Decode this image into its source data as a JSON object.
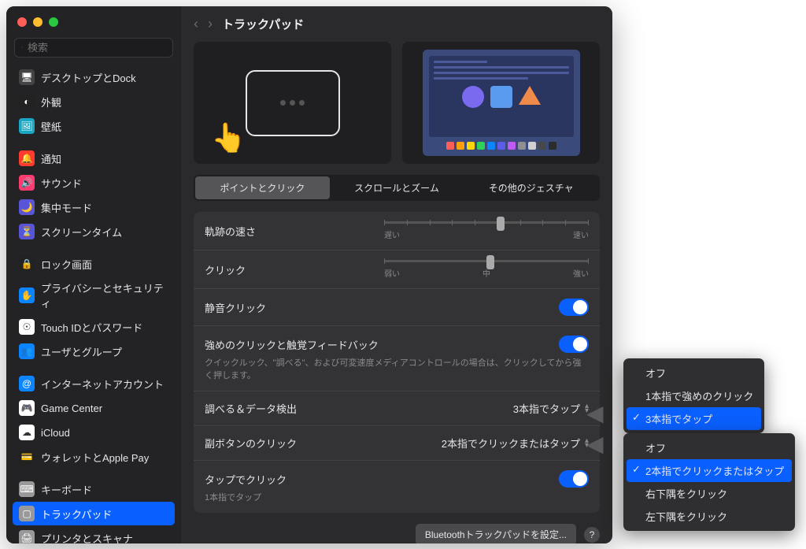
{
  "window": {
    "title": "トラックパッド",
    "search_placeholder": "検索"
  },
  "sidebar": [
    {
      "label": "デスクトップとDock",
      "icon": "desktop",
      "bg": "#444"
    },
    {
      "label": "外観",
      "icon": "appearance",
      "bg": "#222"
    },
    {
      "label": "壁紙",
      "icon": "wallpaper",
      "bg": "#1aa7c4"
    },
    {
      "sep": true
    },
    {
      "label": "通知",
      "icon": "bell",
      "bg": "#ff3b30"
    },
    {
      "label": "サウンド",
      "icon": "sound",
      "bg": "#ff3b70"
    },
    {
      "label": "集中モード",
      "icon": "focus",
      "bg": "#5856d6"
    },
    {
      "label": "スクリーンタイム",
      "icon": "hourglass",
      "bg": "#5856d6"
    },
    {
      "sep": true
    },
    {
      "label": "ロック画面",
      "icon": "lock",
      "bg": "#222"
    },
    {
      "label": "プライバシーとセキュリティ",
      "icon": "privacy",
      "bg": "#0a84ff"
    },
    {
      "label": "Touch IDとパスワード",
      "icon": "touchid",
      "bg": "#fff"
    },
    {
      "label": "ユーザとグループ",
      "icon": "users",
      "bg": "#0a84ff"
    },
    {
      "sep": true
    },
    {
      "label": "インターネットアカウント",
      "icon": "at",
      "bg": "#0a84ff"
    },
    {
      "label": "Game Center",
      "icon": "gamecenter",
      "bg": "#fff"
    },
    {
      "label": "iCloud",
      "icon": "icloud",
      "bg": "#fff"
    },
    {
      "label": "ウォレットとApple Pay",
      "icon": "wallet",
      "bg": "#222"
    },
    {
      "sep": true
    },
    {
      "label": "キーボード",
      "icon": "keyboard",
      "bg": "#999"
    },
    {
      "label": "トラックパッド",
      "icon": "trackpad",
      "bg": "#999",
      "selected": true
    },
    {
      "label": "プリンタとスキャナ",
      "icon": "printer",
      "bg": "#999"
    }
  ],
  "tabs": [
    {
      "label": "ポイントとクリック",
      "active": true
    },
    {
      "label": "スクロールとズーム"
    },
    {
      "label": "その他のジェスチャ"
    }
  ],
  "rows": {
    "tracking": {
      "label": "軌跡の速さ",
      "low": "遅い",
      "high": "速い",
      "pos": 55
    },
    "click": {
      "label": "クリック",
      "low": "弱い",
      "mid": "中",
      "high": "強い",
      "pos": 50
    },
    "silent": {
      "label": "静音クリック",
      "on": true
    },
    "force": {
      "label": "強めのクリックと触覚フィードバック",
      "desc": "クイックルック、\"調べる\"、および可変速度メディアコントロールの場合は、クリックしてから強く押します。",
      "on": true
    },
    "lookup": {
      "label": "調べる＆データ検出",
      "value": "3本指でタップ"
    },
    "secondary": {
      "label": "副ボタンのクリック",
      "value": "2本指でクリックまたはタップ"
    },
    "tap": {
      "label": "タップでクリック",
      "desc": "1本指でタップ",
      "on": true
    }
  },
  "footer": {
    "bluetooth": "Bluetoothトラックパッドを設定...",
    "help": "?"
  },
  "popover1": {
    "options": [
      "オフ",
      "1本指で強めのクリック",
      "3本指でタップ"
    ],
    "selected": 2
  },
  "popover2": {
    "options": [
      "オフ",
      "2本指でクリックまたはタップ",
      "右下隅をクリック",
      "左下隅をクリック"
    ],
    "selected": 1
  }
}
